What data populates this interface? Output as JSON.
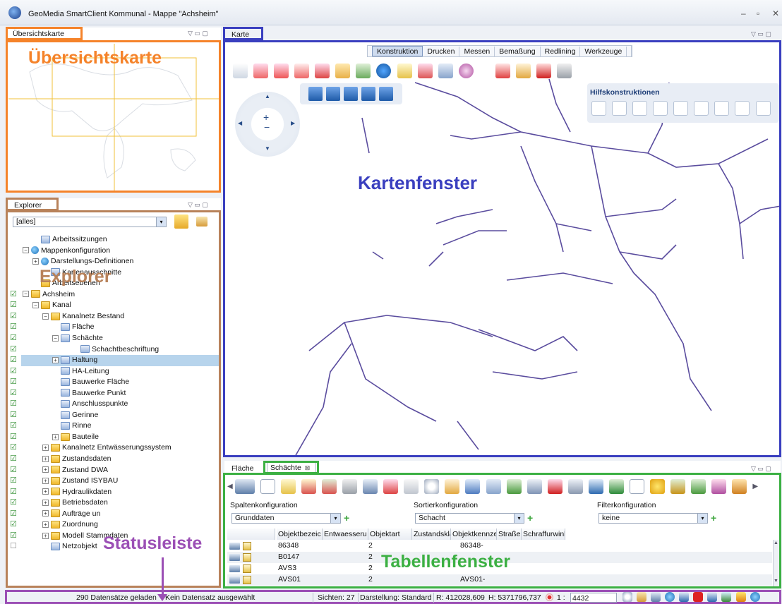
{
  "app": {
    "title": "GeoMedia SmartClient Kommunal - Mappe \"Achsheim\""
  },
  "overview": {
    "tab": "Übersichtskarte",
    "annotation": "Übersichtskarte"
  },
  "explorer": {
    "tab": "Explorer",
    "annotation": "Explorer",
    "filter_value": "[alles]",
    "tree": [
      {
        "label": "Arbeitssitzungen",
        "indent": 1,
        "icon": "layer",
        "exp": "",
        "check": false
      },
      {
        "label": "Mappenkonfiguration",
        "indent": 0,
        "icon": "globe",
        "exp": "⊟",
        "check": false
      },
      {
        "label": "Darstellungs-Definitionen",
        "indent": 1,
        "icon": "globe",
        "exp": "⊞",
        "check": false
      },
      {
        "label": "Kartenausschnitte",
        "indent": 2,
        "icon": "layer",
        "exp": "",
        "check": false
      },
      {
        "label": "Arbeitsebenen",
        "indent": 1,
        "icon": "folder",
        "exp": "",
        "check": false
      },
      {
        "label": "Achsheim",
        "indent": 0,
        "icon": "folder",
        "exp": "⊟",
        "check": true
      },
      {
        "label": "Kanal",
        "indent": 1,
        "icon": "folder",
        "exp": "⊟",
        "check": true
      },
      {
        "label": "Kanalnetz Bestand",
        "indent": 2,
        "icon": "folder",
        "exp": "⊟",
        "check": true
      },
      {
        "label": "Fläche",
        "indent": 3,
        "icon": "layer",
        "exp": "",
        "check": true
      },
      {
        "label": "Schächte",
        "indent": 3,
        "icon": "layer",
        "exp": "⊟",
        "check": true
      },
      {
        "label": "Schachtbeschriftung",
        "indent": 5,
        "icon": "layer",
        "exp": "",
        "check": true
      },
      {
        "label": "Haltung",
        "indent": 3,
        "icon": "layer",
        "exp": "⊞",
        "check": true
      },
      {
        "label": "HA-Leitung",
        "indent": 3,
        "icon": "layer",
        "exp": "",
        "check": true
      },
      {
        "label": "Bauwerke Fläche",
        "indent": 3,
        "icon": "layer",
        "exp": "",
        "check": true
      },
      {
        "label": "Bauwerke Punkt",
        "indent": 3,
        "icon": "layer",
        "exp": "",
        "check": true
      },
      {
        "label": "Anschlusspunkte",
        "indent": 3,
        "icon": "layer",
        "exp": "",
        "check": true
      },
      {
        "label": "Gerinne",
        "indent": 3,
        "icon": "layer",
        "exp": "",
        "check": true
      },
      {
        "label": "Rinne",
        "indent": 3,
        "icon": "layer",
        "exp": "",
        "check": true
      },
      {
        "label": "Bauteile",
        "indent": 3,
        "icon": "folder",
        "exp": "⊞",
        "check": true
      },
      {
        "label": "Kanalnetz Entwässerungssystem",
        "indent": 2,
        "icon": "folder",
        "exp": "⊞",
        "check": true
      },
      {
        "label": "Zustandsdaten",
        "indent": 2,
        "icon": "folder",
        "exp": "⊞",
        "check": true
      },
      {
        "label": "Zustand DWA",
        "indent": 2,
        "icon": "folder",
        "exp": "⊞",
        "check": true
      },
      {
        "label": "Zustand ISYBAU",
        "indent": 2,
        "icon": "folder",
        "exp": "⊞",
        "check": true
      },
      {
        "label": "Hydraulikdaten",
        "indent": 2,
        "icon": "folder",
        "exp": "⊞",
        "check": true
      },
      {
        "label": "Betriebsdaten",
        "indent": 2,
        "icon": "folder",
        "exp": "⊞",
        "check": true
      },
      {
        "label": "Aufträge un",
        "indent": 2,
        "icon": "folder",
        "exp": "⊞",
        "check": true
      },
      {
        "label": "Zuordnung",
        "indent": 2,
        "icon": "folder",
        "exp": "⊞",
        "check": true
      },
      {
        "label": "Modell Stammdaten",
        "indent": 2,
        "icon": "folder",
        "exp": "⊞",
        "check": true
      },
      {
        "label": "Netzobjekt",
        "indent": 2,
        "icon": "layer",
        "exp": "",
        "check": false
      }
    ],
    "selected_label": "Schächte"
  },
  "map": {
    "tab": "Karte",
    "annotation": "Kartenfenster",
    "tool_tabs": [
      "Konstruktion",
      "Drucken",
      "Messen",
      "Bemaßung",
      "Redlining",
      "Werkzeuge"
    ],
    "active_tool_tab": "Konstruktion",
    "hilfs_title": "Hilfskonstruktionen"
  },
  "table": {
    "tabs": [
      "Fläche",
      "Schächte"
    ],
    "annotation": "Tabellenfenster",
    "spalten_label": "Spaltenkonfiguration",
    "spalten_value": "Grunddaten",
    "sort_label": "Sortierkonfiguration",
    "sort_value": "Schacht",
    "filter_label": "Filterkonfiguration",
    "filter_value": "keine",
    "columns": [
      "Objektbezeic",
      "Entwaesseru",
      "Objektart",
      "Zustandsklas",
      "Objektkennze",
      "Straße",
      "Schraffurwinl"
    ],
    "rows": [
      {
        "c1": "86348",
        "c3": "2",
        "c5": "86348-"
      },
      {
        "c1": "B0147",
        "c3": "2",
        "c5": ""
      },
      {
        "c1": "AVS3",
        "c3": "2",
        "c5": ""
      },
      {
        "c1": "AVS01",
        "c3": "2",
        "c5": "AVS01-"
      }
    ]
  },
  "status": {
    "annotation": "Statusleiste",
    "records": "290 Datensätze geladen",
    "selection": "Kein Datensatz ausgewählt",
    "sichten": "Sichten: 27",
    "darstellung": "Darstellung: Standard",
    "r": "R: 412028,609",
    "h": "H: 5371796,737",
    "scale_prefix": "1 :",
    "scale": "4432"
  },
  "colors": {
    "overview": "#f5832a",
    "explorer": "#b8825a",
    "map": "#3a3fbf",
    "table": "#3cb043",
    "status": "#9b4fb5",
    "network": "#5a4c9e"
  }
}
